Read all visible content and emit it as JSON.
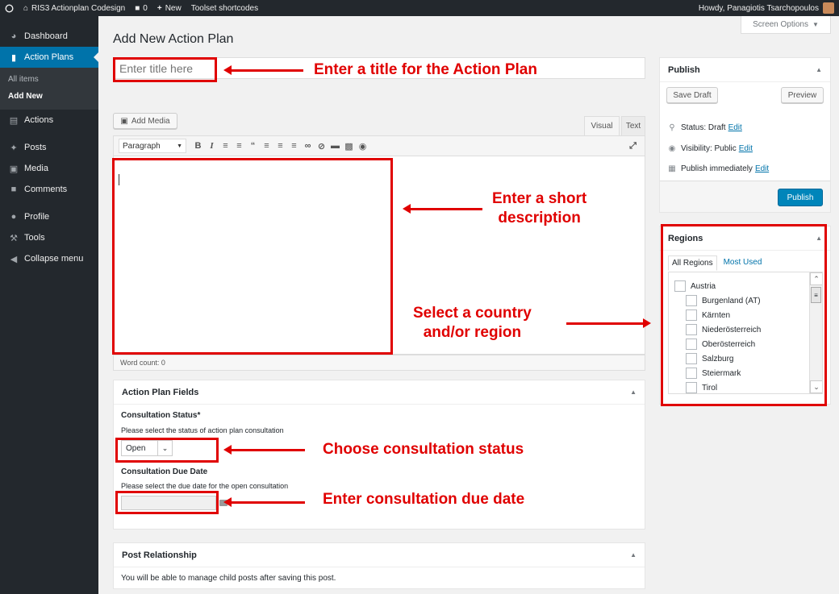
{
  "adminbar": {
    "site_name": "RIS3 Actionplan Codesign",
    "comments_count": "0",
    "new_label": "New",
    "toolset_label": "Toolset shortcodes",
    "howdy": "Howdy, Panagiotis Tsarchopoulos"
  },
  "sidebar": {
    "items": [
      {
        "label": "Dashboard",
        "icon": "dashboard-icon"
      },
      {
        "label": "Action Plans",
        "icon": "action-plans-icon"
      },
      {
        "label": "Actions",
        "icon": "actions-icon"
      },
      {
        "label": "Posts",
        "icon": "pin-icon"
      },
      {
        "label": "Media",
        "icon": "media-icon"
      },
      {
        "label": "Comments",
        "icon": "comments-icon"
      },
      {
        "label": "Profile",
        "icon": "user-icon"
      },
      {
        "label": "Tools",
        "icon": "wrench-icon"
      },
      {
        "label": "Collapse menu",
        "icon": "collapse-icon"
      }
    ],
    "submenu": [
      "All items",
      "Add New"
    ]
  },
  "header": {
    "title": "Add New Action Plan",
    "screen_options": "Screen Options"
  },
  "editor": {
    "title_placeholder": "Enter title here",
    "add_media": "Add Media",
    "tab_visual": "Visual",
    "tab_text": "Text",
    "format": "Paragraph",
    "word_count": "Word count: 0"
  },
  "action_plan_fields": {
    "heading": "Action Plan Fields",
    "status_label": "Consultation Status*",
    "status_help": "Please select the status of action plan consultation",
    "status_value": "Open",
    "date_label": "Consultation Due Date",
    "date_help": "Please select the due date for the open consultation"
  },
  "post_relationship": {
    "heading": "Post Relationship",
    "text": "You will be able to manage child posts after saving this post."
  },
  "publish": {
    "heading": "Publish",
    "save_draft": "Save Draft",
    "preview": "Preview",
    "status": "Status: Draft",
    "visibility": "Visibility: Public",
    "schedule": "Publish immediately",
    "edit": "Edit",
    "publish_button": "Publish"
  },
  "regions": {
    "heading": "Regions",
    "tab_all": "All Regions",
    "tab_most_used": "Most Used",
    "items": [
      "Austria",
      "Burgenland (AT)",
      "Kärnten",
      "Niederösterreich",
      "Oberösterreich",
      "Salzburg",
      "Steiermark",
      "Tirol"
    ]
  },
  "annotations": {
    "title": "Enter a title for the Action Plan",
    "desc_line1": "Enter a short",
    "desc_line2": "description",
    "region_line1": "Select a country",
    "region_line2": "and/or region",
    "status": "Choose consultation status",
    "date": "Enter consultation due date",
    "color": "#e00000"
  }
}
